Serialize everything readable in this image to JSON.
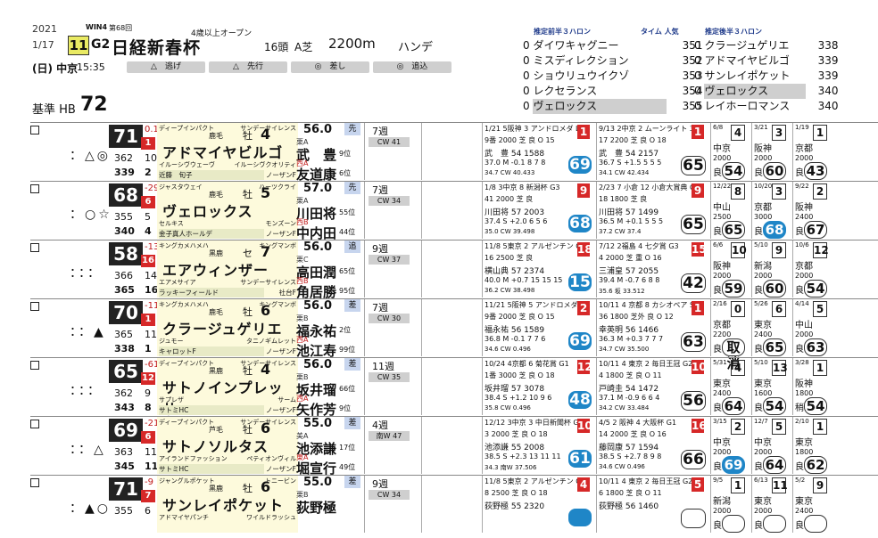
{
  "header": {
    "year": "2021",
    "date": "1/17",
    "day_venue": "(日) 中京",
    "time": "15:35",
    "win4": "WIN4",
    "edition": "第68回",
    "race_num": "11",
    "grade": "G2",
    "race_name": "日経新春杯",
    "conditions": "4歳以上オープン",
    "field": "16頭",
    "course": "A芝",
    "distance": "2200m",
    "handicap": "ハンデ",
    "styles": [
      "△　逃げ",
      "△　先行",
      "◎　差し",
      "◎　追込"
    ],
    "ref_label": "基準 HB",
    "ref_value": "72"
  },
  "predictions": {
    "front_header": "推定前半３ハロン",
    "time_header": "タイム 人気",
    "rear_header": "推定後半３ハロン",
    "front": [
      {
        "rank": "0",
        "name": "ダイワキャグニー",
        "time": "351"
      },
      {
        "rank": "0",
        "name": "ミスディレクション",
        "time": "352"
      },
      {
        "rank": "0",
        "name": "ショウリュウイクゾ",
        "time": "353"
      },
      {
        "rank": "0",
        "name": "レクセランス",
        "time": "354"
      },
      {
        "rank": "0",
        "name": "ヴェロックス",
        "time": "355"
      }
    ],
    "rear": [
      {
        "rank": "0",
        "name": "クラージュゲリエ",
        "time": "338"
      },
      {
        "rank": "0",
        "name": "アドマイヤビルゴ",
        "time": "339"
      },
      {
        "rank": "0",
        "name": "サンレイポケット",
        "time": "339"
      },
      {
        "rank": "0",
        "name": "ヴェロックス",
        "time": "340"
      },
      {
        "rank": "0",
        "name": "レイホーロマンス",
        "time": "340"
      }
    ]
  },
  "horses": [
    {
      "marks": "：△◎",
      "score": "71",
      "delta": "0.1",
      "gate": "1",
      "stat_a": "362",
      "stat_b": "10",
      "stat_c": "339",
      "stat_d": "2",
      "sire": "ディープインパクト",
      "bms": "サンデーサイレンス",
      "color": "鹿毛",
      "sex": "牡",
      "age": "4",
      "name": "アドマイヤビルゴ",
      "dam": "イルーシヴウェーヴ",
      "damsire": "イルーシヴクオリティ",
      "owner": "近藤　旬子",
      "trainer": "ノーザンF",
      "weight": "56.0",
      "style": "先",
      "jloc": "栗A",
      "jockey": "武　豊",
      "jwt": "9位",
      "jlab": "西A",
      "trainer_name": "友道康",
      "tpos": "6位",
      "weeks": "7週",
      "cw": "CW 41",
      "race1": {
        "hd": "1/21 5阪神 3 アンドロメダ L",
        "l2": "9番 2000 芝 良 O 15",
        "l3": "武　豊 54 1588",
        "l4": "37.0 M -0.1 8 7 8",
        "l5": "34.7 CW 40.433",
        "pl": "1",
        "rate": "69"
      },
      "race2": {
        "hd": "9/13 2中京 2 ムーンライト 3C",
        "l2": "17 2200 芝 良 O 18",
        "l3": "武　豊 54 2157",
        "l4": "36.7 S +1.5 5 5 5",
        "l5": "34.1 CW 42.434",
        "pl": "1",
        "rate": "65"
      },
      "minis": [
        {
          "mh": "6/8",
          "num": "4",
          "track": "中京",
          "dist": "2000",
          "cond": "良",
          "rate": "54",
          "blue": false
        },
        {
          "mh": "3/21",
          "num": "3",
          "track": "阪神",
          "dist": "2000",
          "cond": "良",
          "rate": "60",
          "blue": false
        },
        {
          "mh": "1/19",
          "num": "1",
          "track": "京都",
          "dist": "2000",
          "cond": "良",
          "rate": "43",
          "blue": false
        }
      ]
    },
    {
      "marks": "：○☆",
      "score": "68",
      "delta": "-29",
      "gate": "6",
      "stat_a": "355",
      "stat_b": "5",
      "stat_c": "340",
      "stat_d": "4",
      "sire": "ジャスタウェイ",
      "bms": "ハーツクライ",
      "color": "鹿毛",
      "sex": "牡",
      "age": "5",
      "name": "ヴェロックス",
      "dam": "セルキス",
      "damsire": "モンズーン",
      "owner": "金子真人ホールデ",
      "trainer": "ノーザンF",
      "weight": "57.0",
      "style": "先",
      "jloc": "栗A",
      "jockey": "川田将",
      "jwt": "55位",
      "jlab": "西B",
      "trainer_name": "中内田",
      "tpos": "44位",
      "weeks": "7週",
      "cw": "CW 34",
      "race1": {
        "hd": "1/8 3中京 8 新潟杯 G3",
        "l2": "41 2000 芝 良",
        "l3": "川田将 57 2003",
        "l4": "37.4 S +2.0 6 5 6",
        "l5": "35.0 CW 39.498",
        "pl": "9",
        "rate": "68"
      },
      "race2": {
        "hd": "2/23 7 小倉 12 小倉大賞典 G3",
        "l2": "18 1800 芝 良",
        "l3": "川田将 57 1499",
        "l4": "36.5 M +0.1 5 5 5",
        "l5": "37.2 CW 37.4",
        "pl": "9",
        "rate": "65"
      },
      "minis": [
        {
          "mh": "12/22",
          "num": "8",
          "track": "中山",
          "dist": "2500",
          "cond": "良",
          "rate": "65",
          "blue": false
        },
        {
          "mh": "10/20",
          "num": "3",
          "track": "京都",
          "dist": "3000",
          "cond": "良",
          "rate": "68",
          "blue": true
        },
        {
          "mh": "9/22",
          "num": "2",
          "track": "阪神",
          "dist": "2400",
          "cond": "良",
          "rate": "67",
          "blue": false
        }
      ]
    },
    {
      "marks": "：：：",
      "score": "58",
      "delta": "-131",
      "gate": "16",
      "stat_a": "366",
      "stat_b": "14",
      "stat_c": "365",
      "stat_d": "16",
      "sire": "キングカメハメハ",
      "bms": "キングマンボ",
      "color": "黒鹿",
      "sex": "セ",
      "age": "7",
      "name": "エアウィンザー",
      "dam": "エアメサイア",
      "damsire": "サンデーサイレンス",
      "owner": "ラッキーフィールド",
      "trainer": "社台F",
      "weight": "56.0",
      "style": "追",
      "jloc": "栗C",
      "jockey": "高田潤",
      "jwt": "65位",
      "jlab": "西B",
      "trainer_name": "角居勝",
      "tpos": "95位",
      "weeks": "9週",
      "cw": "CW 37",
      "race1": {
        "hd": "11/8 5東京 2 アルゼンチン G2",
        "l2": "16 2500 芝 良",
        "l3": "横山典 57 2374",
        "l4": "40.0 M +0.7 15 15 15",
        "l5": "36.2 CW 38.498",
        "pl": "18",
        "rate": "15"
      },
      "race2": {
        "hd": "7/12 2福島 4 七夕賞 G3",
        "l2": "4 2000 芝 重 O 16",
        "l3": "三浦皇 57 2055",
        "l4": "39.4 M -0.7 6 8 8",
        "l5": "35.6 坂 33.512",
        "pl": "15",
        "rate": "42"
      },
      "minis": [
        {
          "mh": "6/6",
          "num": "10",
          "track": "阪神",
          "dist": "2000",
          "cond": "良",
          "rate": "59",
          "blue": false
        },
        {
          "mh": "5/10",
          "num": "9",
          "track": "新潟",
          "dist": "2000",
          "cond": "良",
          "rate": "60",
          "blue": false
        },
        {
          "mh": "10/6",
          "num": "12",
          "track": "京都",
          "dist": "2000",
          "cond": "良",
          "rate": "54",
          "blue": false
        }
      ]
    },
    {
      "marks": "：：▲",
      "score": "70",
      "delta": "-11",
      "gate": "1",
      "stat_a": "365",
      "stat_b": "11",
      "stat_c": "338",
      "stat_d": "1",
      "sire": "キングカメハメハ",
      "bms": "キングマンボ",
      "color": "鹿毛",
      "sex": "牡",
      "age": "6",
      "name": "クラージュゲリエ",
      "dam": "ジュモー",
      "damsire": "タニノギムレット",
      "owner": "キャロットF",
      "trainer": "ノーザンF",
      "weight": "56.0",
      "style": "差",
      "jloc": "栗B",
      "jockey": "福永祐",
      "jwt": "2位",
      "jlab": "西A",
      "trainer_name": "池江寿",
      "tpos": "99位",
      "weeks": "7週",
      "cw": "CW 30",
      "race1": {
        "hd": "11/21 5阪神 5 アンドロメダ L",
        "l2": "9番 2000 芝 良 O 15",
        "l3": "福永祐 56 1589",
        "l4": "36.8 M -0.1 7 7 6",
        "l5": "34.6 CW 0.496",
        "pl": "2",
        "rate": "69"
      },
      "race2": {
        "hd": "10/11 4 京都 8 カシオペア S L",
        "l2": "36 1800 芝外 良 O 12",
        "l3": "幸英明 56 1466",
        "l4": "36.3 M +0.3 7 7 7",
        "l5": "34.7 CW 35.500",
        "pl": "1",
        "rate": "63"
      },
      "minis": [
        {
          "mh": "2/16",
          "num": "0",
          "track": "京都",
          "dist": "2200",
          "cond": "良",
          "rate": "取消",
          "blue": false
        },
        {
          "mh": "5/26",
          "num": "6",
          "track": "東京",
          "dist": "2400",
          "cond": "良",
          "rate": "65",
          "blue": false
        },
        {
          "mh": "4/14",
          "num": "5",
          "track": "中山",
          "dist": "2000",
          "cond": "良",
          "rate": "63",
          "blue": false
        }
      ]
    },
    {
      "marks": "：：：",
      "score": "65",
      "delta": "-61",
      "gate": "12",
      "stat_a": "362",
      "stat_b": "9",
      "stat_c": "343",
      "stat_d": "8",
      "sire": "ディープインパクト",
      "bms": "サンデーサイレンス",
      "color": "黒鹿",
      "sex": "牡",
      "age": "4",
      "name": "サトノインプレッサ",
      "dam": "サプレザ",
      "damsire": "サーム",
      "owner": "サトミHC",
      "trainer": "ノーザンF",
      "weight": "56.0",
      "style": "差",
      "jloc": "栗B",
      "jockey": "坂井瑠",
      "jwt": "66位",
      "jlab": "西A",
      "trainer_name": "矢作芳",
      "tpos": "9位",
      "weeks": "11週",
      "cw": "CW 35",
      "race1": {
        "hd": "10/24 4京都 6 菊花賞 G1",
        "l2": "1番 3000 芝 良 O 18",
        "l3": "坂井瑠 57 3078",
        "l4": "38.4 S +1.2 10 9 6",
        "l5": "35.8 CW 0.496",
        "pl": "12",
        "rate": "48"
      },
      "race2": {
        "hd": "10/11 4 東京 2 毎日王冠 G2",
        "l2": "4 1800 芝 良 O 11",
        "l3": "戸崎圭 54 1472",
        "l4": "37.1 M -0.9 6 6 4",
        "l5": "34.2 CW 33.484",
        "pl": "10",
        "rate": "56"
      },
      "minis": [
        {
          "mh": "5/31",
          "num": "4",
          "track": "東京",
          "dist": "2400",
          "cond": "良",
          "rate": "64",
          "blue": false
        },
        {
          "mh": "5/10",
          "num": "13",
          "track": "東京",
          "dist": "1600",
          "cond": "良",
          "rate": "54",
          "blue": false
        },
        {
          "mh": "3/28",
          "num": "1",
          "track": "阪神",
          "dist": "1800",
          "cond": "稍",
          "rate": "54",
          "blue": false
        }
      ]
    },
    {
      "marks": "：：△",
      "score": "69",
      "delta": "-21",
      "gate": "6",
      "stat_a": "363",
      "stat_b": "11",
      "stat_c": "345",
      "stat_d": "11",
      "sire": "ディープインパクト",
      "bms": "サンデーサイレンス",
      "color": "芦毛",
      "sex": "牡",
      "age": "6",
      "name": "サトノソルタス",
      "dam": "アイランドファッション",
      "damsire": "ペティオンヴィル",
      "owner": "サトミHC",
      "trainer": "ノーザンF",
      "weight": "55.0",
      "style": "差",
      "jloc": "美A",
      "jockey": "池添謙",
      "jwt": "17位",
      "jlab": "東A",
      "trainer_name": "堀宣行",
      "tpos": "49位",
      "weeks": "4週",
      "cw": "南W 47",
      "race1": {
        "hd": "12/12 3中京 3 中日新聞杯 G3",
        "l2": "3 2000 芝 良 O 18",
        "l3": "池添謙 55 2008",
        "l4": "38.5 S +2.3 13 11 11",
        "l5": "34.3 南W 37.506",
        "pl": "10",
        "rate": "61"
      },
      "race2": {
        "hd": "4/5 2 阪神 4 大阪杯 G1",
        "l2": "14 2000 芝 良 O 16",
        "l3": "藤岡康 57 1594",
        "l4": "38.5 S +2.7 8 9 8",
        "l5": "34.6 CW 0.496",
        "pl": "16",
        "rate": "66"
      },
      "minis": [
        {
          "mh": "3/15",
          "num": "2",
          "track": "中京",
          "dist": "2000",
          "cond": "良",
          "rate": "69",
          "blue": true
        },
        {
          "mh": "12/7",
          "num": "5",
          "track": "中京",
          "dist": "2000",
          "cond": "良",
          "rate": "64",
          "blue": false
        },
        {
          "mh": "2/10",
          "num": "1",
          "track": "東京",
          "dist": "1800",
          "cond": "良",
          "rate": "62",
          "blue": false
        }
      ]
    },
    {
      "marks": "：▲○",
      "score": "71",
      "delta": "-9",
      "gate": "7",
      "stat_a": "355",
      "stat_b": "6",
      "stat_c": "",
      "stat_d": "",
      "sire": "ジャングルポケット",
      "bms": "トニービン",
      "color": "黒鹿",
      "sex": "牡",
      "age": "6",
      "name": "サンレイポケット",
      "dam": "アドマイヤパンチ",
      "damsire": "ワイルドラッシュ",
      "owner": "",
      "trainer": "",
      "weight": "55.0",
      "style": "差",
      "jloc": "栗B",
      "jockey": "荻野極",
      "jwt": "",
      "jlab": "",
      "trainer_name": "",
      "tpos": "",
      "weeks": "9週",
      "cw": "CW 34",
      "race1": {
        "hd": "11/8 5東京 2 アルゼンチン G2",
        "l2": "8 2500 芝 良 O 18",
        "l3": "荻野極 55 2320",
        "l4": "",
        "l5": "",
        "pl": "4",
        "rate": ""
      },
      "race2": {
        "hd": "10/11 4 東京 2 毎日王冠 G2",
        "l2": "6 1800 芝 良 O 11",
        "l3": "荻野極 56 1460",
        "l4": "",
        "l5": "",
        "pl": "5",
        "rate": ""
      },
      "minis": [
        {
          "mh": "9/5",
          "num": "1",
          "track": "新潟",
          "dist": "2000",
          "cond": "良",
          "rate": "",
          "blue": false
        },
        {
          "mh": "6/13",
          "num": "11",
          "track": "東京",
          "dist": "2000",
          "cond": "良",
          "rate": "",
          "blue": false
        },
        {
          "mh": "5/2",
          "num": "9",
          "track": "東京",
          "dist": "2400",
          "cond": "良",
          "rate": "",
          "blue": false
        }
      ]
    }
  ]
}
